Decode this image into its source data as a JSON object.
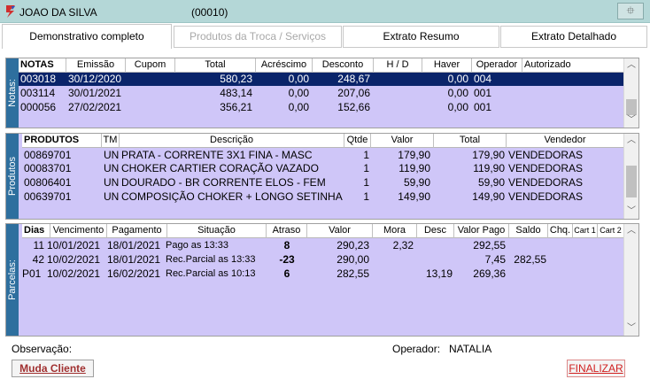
{
  "window": {
    "customer_name": "JOAO DA SILVA",
    "customer_code": "(00010)",
    "close_glyph": "⯐"
  },
  "tabs": [
    {
      "label": "Demonstrativo completo"
    },
    {
      "label": "Produtos da Troca / Serviços"
    },
    {
      "label": "Extrato Resumo"
    },
    {
      "label": "Extrato Detalhado"
    }
  ],
  "notas": {
    "side_label": "Notas:",
    "headers": [
      "NOTAS",
      "Emissão",
      "Cupom",
      "Total",
      "Acréscimo",
      "Desconto",
      "H / D",
      "Haver",
      "Operador",
      "Autorizado"
    ],
    "rows": [
      [
        "003018",
        "30/12/2020",
        "",
        "580,23",
        "0,00",
        "248,67",
        "",
        "0,00",
        "004",
        ""
      ],
      [
        "003114",
        "30/01/2021",
        "",
        "483,14",
        "0,00",
        "207,06",
        "",
        "0,00",
        "001",
        ""
      ],
      [
        "000056",
        "27/02/2021",
        "",
        "356,21",
        "0,00",
        "152,66",
        "",
        "0,00",
        "001",
        ""
      ]
    ]
  },
  "produtos": {
    "side_label": "Produtos",
    "headers": [
      "PRODUTOS",
      "TM",
      "Descrição",
      "Qtde",
      "Valor",
      "Total",
      "Vendedor"
    ],
    "rows": [
      [
        "00869701",
        "UN",
        "PRATA - CORRENTE 3X1 FINA - MASC",
        "1",
        "179,90",
        "179,90",
        "VENDEDORAS"
      ],
      [
        "00083701",
        "UN",
        "CHOKER CARTIER CORAÇÃO VAZADO",
        "1",
        "119,90",
        "119,90",
        "VENDEDORAS"
      ],
      [
        "00806401",
        "UN",
        "DOURADO - BR CORRENTE ELOS - FEM",
        "1",
        "59,90",
        "59,90",
        "VENDEDORAS"
      ],
      [
        "00639701",
        "UN",
        "COMPOSIÇÃO CHOKER + LONGO SETINHA",
        "1",
        "149,90",
        "149,90",
        "VENDEDORAS"
      ]
    ]
  },
  "parcelas": {
    "side_label": "Parcelas:",
    "headers": [
      "Dias",
      "Vencimento",
      "Pagamento",
      "Situação",
      "Atraso",
      "Valor",
      "Mora",
      "Desc",
      "Valor Pago",
      "Saldo",
      "Chq.",
      "Cart 1",
      "Cart 2"
    ],
    "rows": [
      [
        "11",
        "10/01/2021",
        "18/01/2021",
        "Pago as 13:33",
        "8",
        "290,23",
        "2,32",
        "",
        "292,55",
        "",
        "",
        "",
        ""
      ],
      [
        "42",
        "10/02/2021",
        "18/01/2021",
        "Rec.Parcial as 13:33",
        "-23",
        "290,00",
        "",
        "",
        "7,45",
        "282,55",
        "",
        "",
        ""
      ],
      [
        "P01",
        "10/02/2021",
        "16/02/2021",
        "Rec.Parcial as 10:13",
        "6",
        "282,55",
        "",
        "13,19",
        "269,36",
        "",
        "",
        "",
        ""
      ]
    ]
  },
  "footer": {
    "observacao_label": "Observação:",
    "operador_label": "Operador:",
    "operador_value": "NATALIA",
    "muda_cliente": "Muda Cliente",
    "finalizar": "FINALIZAR"
  },
  "colors": {
    "grid_bg": "#cfc6f8",
    "selected_row": "#0a246a",
    "side_label_bg": "#2e6f9e",
    "titlebar": "#b4d7d7"
  }
}
